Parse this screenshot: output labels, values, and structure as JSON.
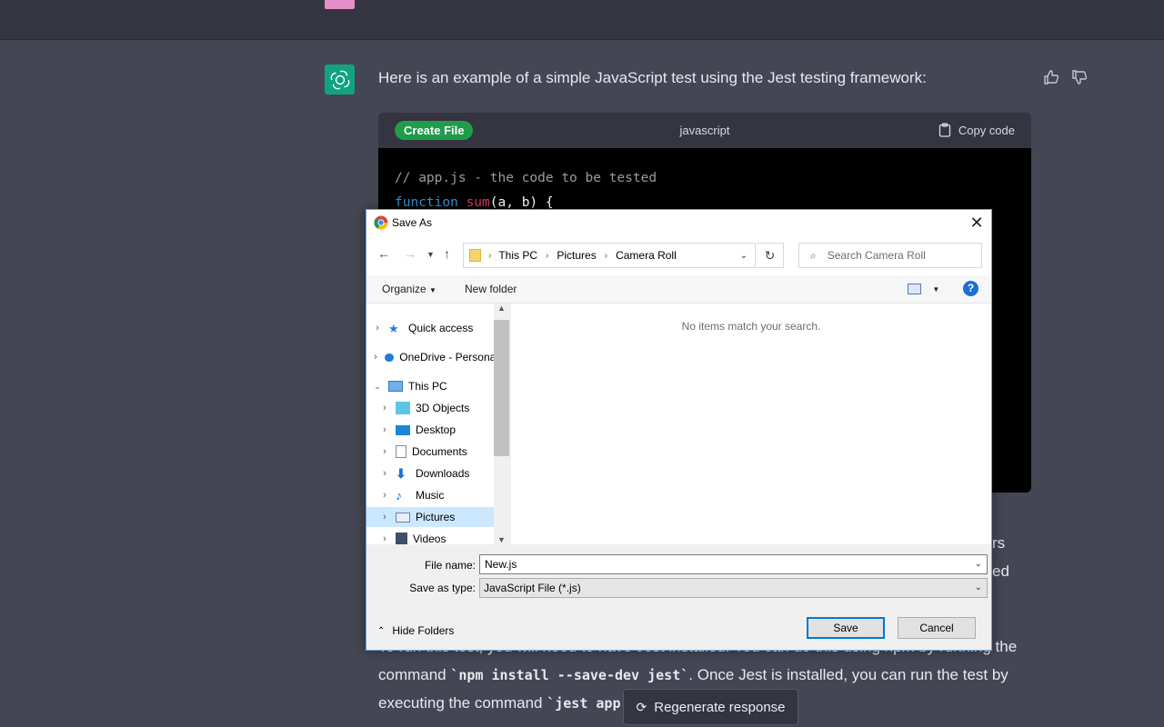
{
  "chat": {
    "message": "Here is an example of a simple JavaScript test using the Jest testing framework:",
    "code_block": {
      "create_file_label": "Create File",
      "language": "javascript",
      "copy_label": "Copy code",
      "line1": "// app.js - the code to be tested",
      "line2_kw": "function",
      "line2_fn": "sum",
      "line2_rest": "(a, b) {"
    },
    "para1_frag1": "rs",
    "para1_frag2": "ed",
    "para2_line1": "To run this test, you will need to have Jest installed. You can do this using npm by running the",
    "para2_line2_a": "command ",
    "para2_line2_code": "`npm install --save-dev jest`",
    "para2_line2_b": ". Once Jest is installed, you can run the test by",
    "para2_line3_a": "executing the command ",
    "para2_line3_code": "`jest app",
    "regenerate_label": "Regenerate response"
  },
  "dialog": {
    "title": "Save As",
    "breadcrumb": [
      "This PC",
      "Pictures",
      "Camera Roll"
    ],
    "search_placeholder": "Search Camera Roll",
    "organize_label": "Organize",
    "new_folder_label": "New folder",
    "empty_message": "No items match your search.",
    "nav_items": [
      {
        "label": "Quick access",
        "icon": "star-icon"
      },
      {
        "label": "OneDrive - Personal",
        "icon": "cloud-icon"
      },
      {
        "label": "This PC",
        "icon": "computer-icon"
      },
      {
        "label": "3D Objects",
        "icon": "cube-icon"
      },
      {
        "label": "Desktop",
        "icon": "desktop-icon"
      },
      {
        "label": "Documents",
        "icon": "document-icon"
      },
      {
        "label": "Downloads",
        "icon": "download-icon"
      },
      {
        "label": "Music",
        "icon": "music-icon"
      },
      {
        "label": "Pictures",
        "icon": "picture-icon"
      },
      {
        "label": "Videos",
        "icon": "video-icon"
      }
    ],
    "file_name_label": "File name:",
    "file_name_value": "New.js",
    "save_type_label": "Save as type:",
    "save_type_value": "JavaScript File (*.js)",
    "hide_folders_label": "Hide Folders",
    "save_label": "Save",
    "cancel_label": "Cancel"
  },
  "colors": {
    "background": "#444654",
    "accent_green": "#10a37f",
    "create_file_green": "#1f9d4a",
    "selection_blue": "#cce8ff",
    "primary_button_border": "#0078d7"
  }
}
